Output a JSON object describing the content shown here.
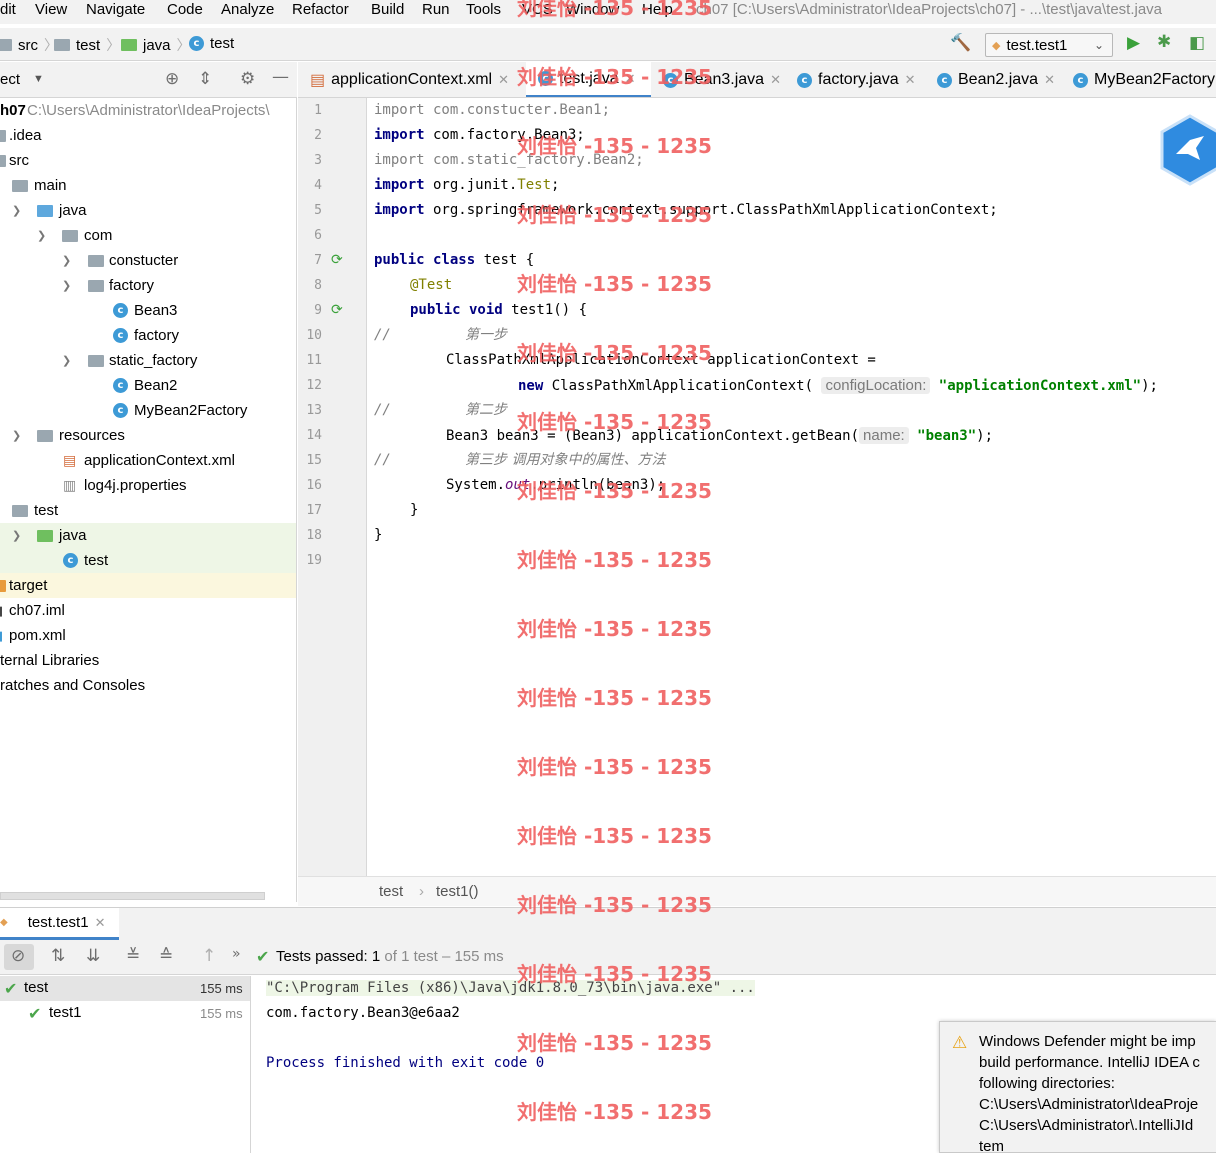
{
  "menu": [
    "dit",
    "View",
    "Navigate",
    "Code",
    "Analyze",
    "Refactor",
    "Build",
    "Run",
    "Tools",
    "VCS",
    "Window",
    "Help"
  ],
  "window_title": "ch07 [C:\\Users\\Administrator\\IdeaProjects\\ch07] - ...\\test\\java\\test.java",
  "breadcrumbs": [
    "src",
    "test",
    "java",
    "test"
  ],
  "run_config": "test.test1",
  "project_panel": {
    "title": "ect",
    "root_name": "h07",
    "root_path": "C:\\Users\\Administrator\\IdeaProjects\\",
    "nodes": [
      ".idea",
      "src",
      "main",
      "java",
      "com",
      "constucter",
      "factory",
      "Bean3",
      "factory",
      "static_factory",
      "Bean2",
      "MyBean2Factory",
      "resources",
      "applicationContext.xml",
      "log4j.properties",
      "test",
      "java",
      "test",
      "target",
      "ch07.iml",
      "pom.xml",
      "ternal Libraries",
      "ratches and Consoles"
    ]
  },
  "editor_tabs": [
    "applicationContext.xml",
    "test.java",
    "Bean3.java",
    "factory.java",
    "Bean2.java",
    "MyBean2Factory"
  ],
  "line_numbers": [
    "1",
    "2",
    "3",
    "4",
    "5",
    "6",
    "7",
    "8",
    "9",
    "10",
    "11",
    "12",
    "13",
    "14",
    "15",
    "16",
    "17",
    "18",
    "19"
  ],
  "code": {
    "l1": "import com.constucter.Bean1;",
    "l2_kw": "import",
    "l2_rest": " com.factory.Bean3;",
    "l3": "import com.static_factory.Bean2;",
    "l4_kw": "import",
    "l4_a": " org.junit.",
    "l4_b": "Test",
    "l4_c": ";",
    "l5_kw": "import",
    "l5_rest": " org.springframework.context.support.ClassPathXmlApplicationContext;",
    "l7_kw": "public class",
    "l7_rest": " test {",
    "l8": "@Test",
    "l9_kw": "public void",
    "l9_rest": " test1() {",
    "l10_a": "//",
    "l10_b": "第一步",
    "l11": "ClassPathXmlApplicationContext applicationContext =",
    "l12_kw": "new",
    "l12_rest": " ClassPathXmlApplicationContext(",
    "l12_hint": "configLocation:",
    "l12_str": "\"applicationContext.xml\"",
    "l12_end": ");",
    "l13_a": "//",
    "l13_b": "第二步",
    "l14_a": "Bean3 bean3 = (Bean3) applicationContext.getBean(",
    "l14_hint": "name:",
    "l14_str": "\"bean3\"",
    "l14_end": ");",
    "l15_a": "//",
    "l15_b": "第三步 调用对象中的属性、方法",
    "l16_a": "System.",
    "l16_b": "out",
    "l16_c": ".println(bean3);",
    "l17": "}",
    "l18": "}"
  },
  "editor_breadcrumb": [
    "test",
    "test1()"
  ],
  "run_panel": {
    "tab": "test.test1",
    "status_prefix": "Tests passed:",
    "status_count": "1",
    "status_rest": "of 1 test – 155 ms",
    "tests": [
      {
        "name": "test",
        "time": "155 ms"
      },
      {
        "name": "test1",
        "time": "155 ms"
      }
    ],
    "console": [
      "\"C:\\Program Files (x86)\\Java\\jdk1.8.0_73\\bin\\java.exe\" ...",
      "com.factory.Bean3@e6aa2",
      "Process finished with exit code 0"
    ]
  },
  "notification": {
    "lines": [
      "Windows Defender might be imp",
      "build performance. IntelliJ IDEA c",
      "following directories:",
      "C:\\Users\\Administrator\\IdeaProje",
      "C:\\Users\\Administrator\\.IntelliJId",
      "tem"
    ]
  },
  "watermark": "刘佳怡 -135 - 1235",
  "colors": {
    "keyword": "#000080",
    "string": "#008000",
    "annotation": "#808000",
    "comment": "#808080",
    "watermark": "#f06060",
    "accent": "#4083c9"
  }
}
